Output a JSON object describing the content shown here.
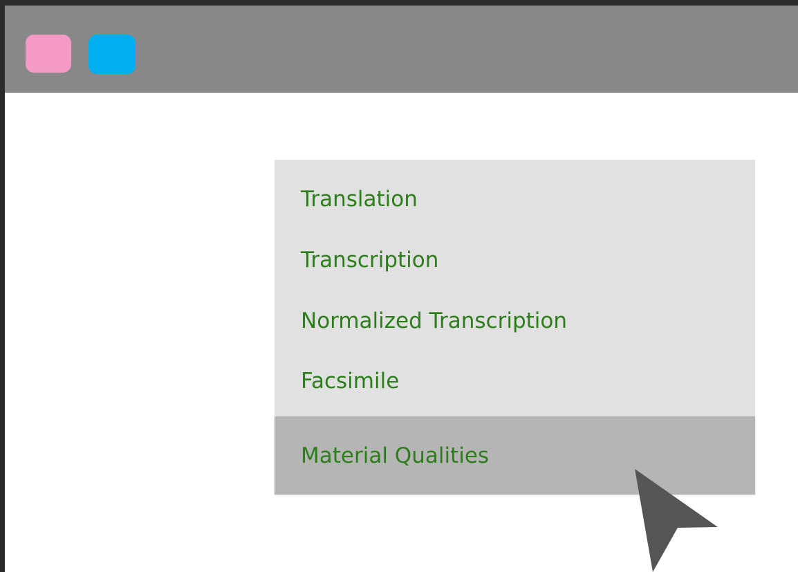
{
  "window": {
    "buttons": [
      {
        "name": "pink-window-button",
        "color": "#f49ac5"
      },
      {
        "name": "blue-window-button",
        "color": "#00adef"
      }
    ]
  },
  "menu": {
    "text_color": "#2e7d1c",
    "hover_color": "#b5b5b5",
    "items": [
      {
        "label": "Translation"
      },
      {
        "label": "Transcription"
      },
      {
        "label": "Normalized Transcription"
      },
      {
        "label": "Facsimile"
      },
      {
        "label": "Material Qualities",
        "hovered": true
      }
    ]
  },
  "cursor": {
    "icon": "mouse-pointer-icon",
    "color": "#555555"
  }
}
